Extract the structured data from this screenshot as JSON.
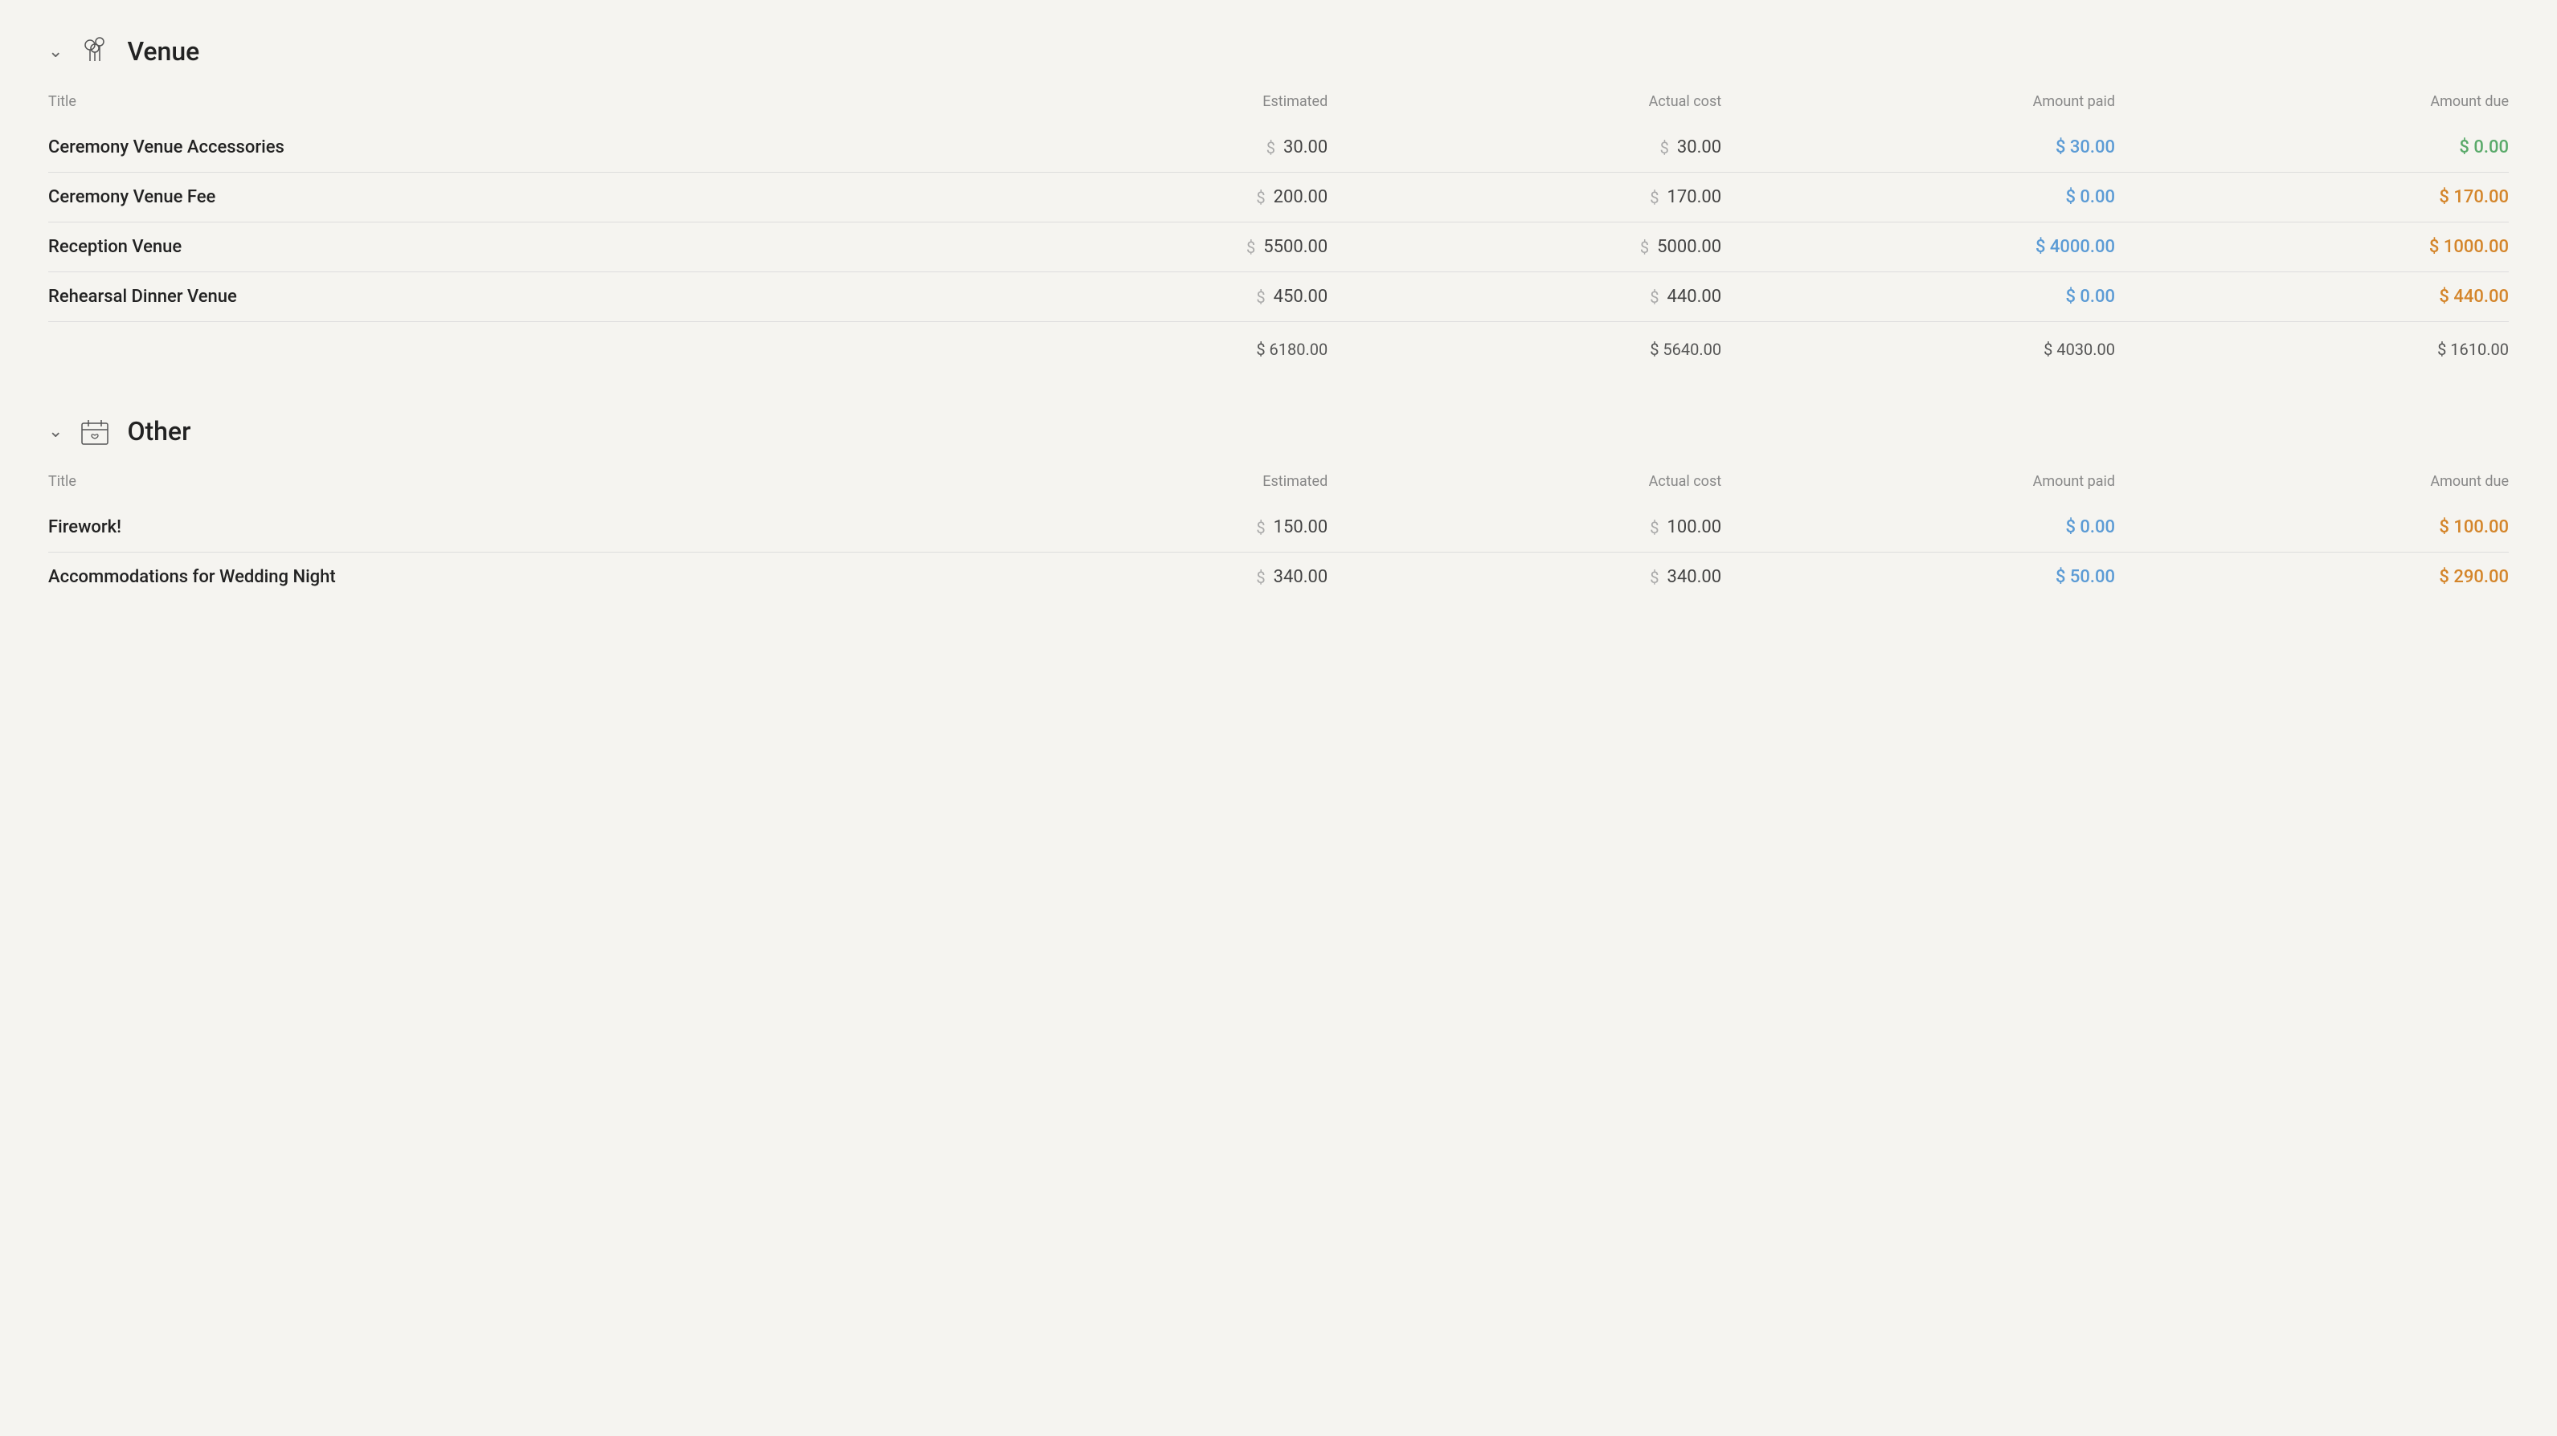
{
  "sections": [
    {
      "id": "venue",
      "title": "Venue",
      "icon": "venue-icon",
      "columns": {
        "title": "Title",
        "estimated": "Estimated",
        "actual_cost": "Actual cost",
        "amount_paid": "Amount paid",
        "amount_due": "Amount due"
      },
      "items": [
        {
          "name": "Ceremony Venue Accessories",
          "estimated": "30.00",
          "actual": "30.00",
          "paid": "30.00",
          "due": "0.00",
          "paid_color": "blue",
          "due_color": "green"
        },
        {
          "name": "Ceremony Venue Fee",
          "estimated": "200.00",
          "actual": "170.00",
          "paid": "0.00",
          "due": "170.00",
          "paid_color": "blue",
          "due_color": "orange"
        },
        {
          "name": "Reception Venue",
          "estimated": "5500.00",
          "actual": "5000.00",
          "paid": "4000.00",
          "due": "1000.00",
          "paid_color": "blue",
          "due_color": "orange"
        },
        {
          "name": "Rehearsal Dinner Venue",
          "estimated": "450.00",
          "actual": "440.00",
          "paid": "0.00",
          "due": "440.00",
          "paid_color": "blue",
          "due_color": "orange"
        }
      ],
      "totals": {
        "estimated": "6180.00",
        "actual": "5640.00",
        "paid": "4030.00",
        "due": "1610.00"
      }
    },
    {
      "id": "other",
      "title": "Other",
      "icon": "other-icon",
      "columns": {
        "title": "Title",
        "estimated": "Estimated",
        "actual_cost": "Actual cost",
        "amount_paid": "Amount paid",
        "amount_due": "Amount due"
      },
      "items": [
        {
          "name": "Firework!",
          "estimated": "150.00",
          "actual": "100.00",
          "paid": "0.00",
          "due": "100.00",
          "paid_color": "blue",
          "due_color": "orange"
        },
        {
          "name": "Accommodations for Wedding Night",
          "estimated": "340.00",
          "actual": "340.00",
          "paid": "50.00",
          "due": "290.00",
          "paid_color": "blue",
          "due_color": "orange"
        }
      ]
    }
  ]
}
